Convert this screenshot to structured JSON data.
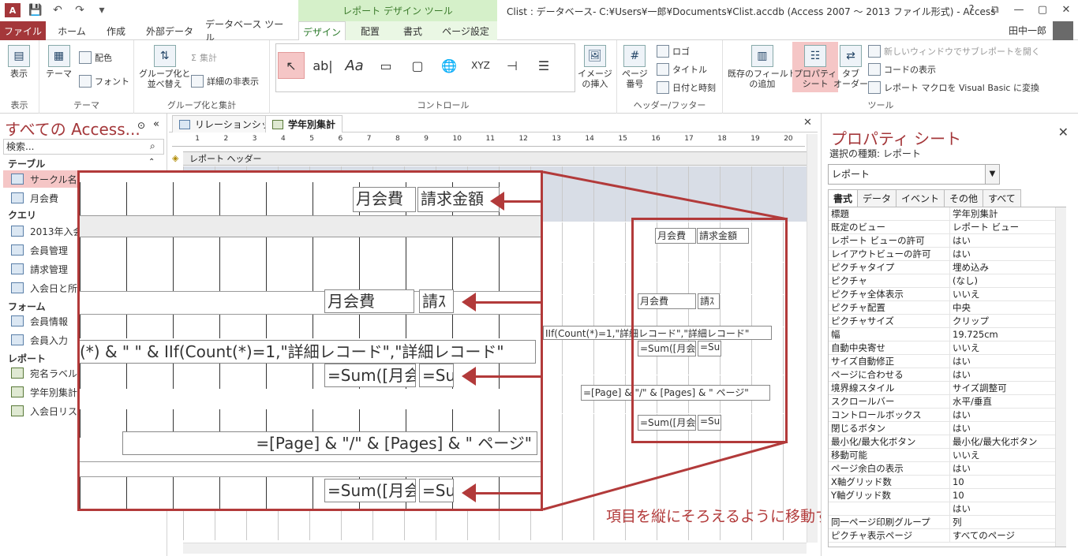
{
  "window": {
    "title": "Clist : データベース- C:¥Users¥一郎¥Documents¥Clist.accdb (Access 2007 ～ 2013 ファイル形式) - Access",
    "context_tab_group": "レポート デザイン ツール",
    "user": "田中一郎",
    "controls": {
      "help": "?",
      "restore": "⧉",
      "minimize": "—",
      "maximize": "▢",
      "close": "✕"
    }
  },
  "quick_access": {
    "app": "A",
    "save": "💾",
    "undo": "↶",
    "redo": "↷",
    "more": "▾"
  },
  "tabs": {
    "file": "ファイル",
    "home": "ホーム",
    "create": "作成",
    "external": "外部データ",
    "dbtools": "データベース ツール",
    "design": "デザイン",
    "arrange": "配置",
    "format": "書式",
    "page_setup": "ページ設定"
  },
  "ribbon": {
    "view": {
      "btn": "表示",
      "group": "表示"
    },
    "theme": {
      "themes": "テーマ",
      "colors": "配色",
      "fonts": "フォント",
      "group": "テーマ"
    },
    "grouping": {
      "group_sort": "グループ化と\n並べ替え",
      "totals": "集計",
      "hide_details": "詳細の非表示",
      "group": "グループ化と集計"
    },
    "controls": {
      "label": "Aa",
      "insert_image": "イメージ\nの挿入",
      "group": "コントロール"
    },
    "header_footer": {
      "page_num": "ページ\n番号",
      "logo": "ロゴ",
      "title": "タイトル",
      "datetime": "日付と時刻",
      "group": "ヘッダー/フッター"
    },
    "tools": {
      "add_fields": "既存のフィールド\nの追加",
      "property_sheet": "プロパティ\nシート",
      "tab_order": "タブ\nオーダー",
      "subreport_new_window": "新しいウィンドウでサブレポートを開く",
      "view_code": "コードの表示",
      "convert_macro": "レポート マクロを Visual Basic に変換",
      "group": "ツール"
    }
  },
  "nav": {
    "title": "すべての Access...",
    "search_placeholder": "検索...",
    "sections": [
      {
        "name": "テーブル",
        "items": [
          "サークル名簿",
          "月会費"
        ]
      },
      {
        "name": "クエリ",
        "items": [
          "2013年入会",
          "会員管理",
          "請求管理",
          "入会日と所"
        ]
      },
      {
        "name": "フォーム",
        "items": [
          "会員情報",
          "会員入力"
        ]
      },
      {
        "name": "レポート",
        "items": [
          "宛名ラベル",
          "学年別集計",
          "入会日リス"
        ]
      }
    ]
  },
  "doc_tabs": {
    "relationship": "リレーションシップ",
    "report": "学年別集計"
  },
  "design": {
    "ruler_marks": [
      "1",
      "2",
      "3",
      "4",
      "5",
      "6",
      "7",
      "8",
      "9",
      "10",
      "11",
      "12",
      "13",
      "14",
      "15",
      "16",
      "17",
      "18",
      "19",
      "20"
    ],
    "band_report_header": "レポート ヘッダー",
    "fields": {
      "monthly_fee": "月会費",
      "billing": "請求金額",
      "billing_short": "請ｽ",
      "count_expr": "IIf(Count(*)=1,\"詳細レコード\",\"詳細レコード\"",
      "sum_month": "=Sum([月会",
      "sum_short": "=Su",
      "page_expr": "=[Page] & \"/\" & [Pages] & \" ページ\""
    }
  },
  "zoom": {
    "monthly_fee": "月会費",
    "billing": "請求金額",
    "billing_short": "請ｽ",
    "count_expr": "(*) & \" \" & IIf(Count(*)=1,\"詳細レコード\",\"詳細レコード\"",
    "sum_month": "=Sum([月会",
    "sum_short": "=Su",
    "page_expr": "=[Page] & \"/\" & [Pages] & \" ページ\""
  },
  "annotation": "項目を縦にそろえるように移動する",
  "props": {
    "title": "プロパティ シート",
    "selection_type": "選択の種類: レポート",
    "selected": "レポート",
    "tabs": [
      "書式",
      "データ",
      "イベント",
      "その他",
      "すべて"
    ],
    "rows": [
      [
        "標題",
        "学年別集計"
      ],
      [
        "既定のビュー",
        "レポート ビュー"
      ],
      [
        "レポート ビューの許可",
        "はい"
      ],
      [
        "レイアウトビューの許可",
        "はい"
      ],
      [
        "ピクチャタイプ",
        "埋め込み"
      ],
      [
        "ピクチャ",
        "(なし)"
      ],
      [
        "ピクチャ全体表示",
        "いいえ"
      ],
      [
        "ピクチャ配置",
        "中央"
      ],
      [
        "ピクチャサイズ",
        "クリップ"
      ],
      [
        "幅",
        "19.725cm"
      ],
      [
        "自動中央寄せ",
        "いいえ"
      ],
      [
        "サイズ自動修正",
        "はい"
      ],
      [
        "ページに合わせる",
        "はい"
      ],
      [
        "境界線スタイル",
        "サイズ調整可"
      ],
      [
        "スクロールバー",
        "水平/垂直"
      ],
      [
        "コントロールボックス",
        "はい"
      ],
      [
        "閉じるボタン",
        "はい"
      ],
      [
        "最小化/最大化ボタン",
        "最小化/最大化ボタン"
      ],
      [
        "移動可能",
        "いいえ"
      ],
      [
        "ページ余白の表示",
        "はい"
      ],
      [
        "X軸グリッド数",
        "10"
      ],
      [
        "Y軸グリッド数",
        "10"
      ],
      [
        "",
        "はい"
      ],
      [
        "同一ページ印刷グループ",
        "列"
      ],
      [
        "ピクチャ表示ページ",
        "すべてのページ"
      ]
    ]
  },
  "colors": {
    "accent": "#a4373a",
    "context": "#d5f0c9",
    "annotation": "#b23a3a"
  }
}
